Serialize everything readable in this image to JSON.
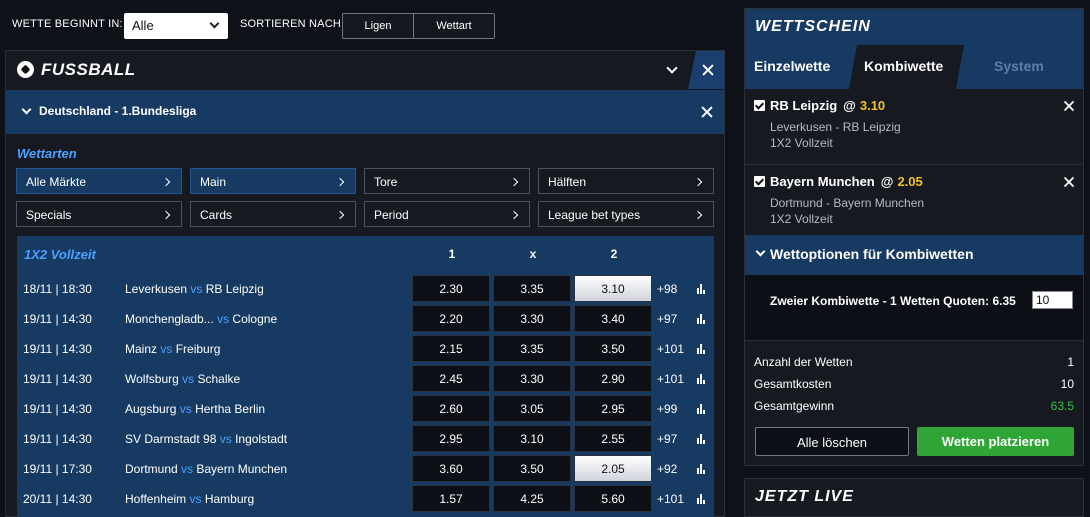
{
  "filter": {
    "start_label": "WETTE BEGINNT IN:",
    "start_value": "Alle",
    "sort_label": "SORTIEREN NACH:",
    "sort_options": [
      "Ligen",
      "Wettart"
    ]
  },
  "sport": {
    "title": "FUSSBALL",
    "icon": "soccer-ball-icon"
  },
  "league": {
    "title": "Deutschland - 1.Bundesliga"
  },
  "wettarten": {
    "title": "Wettarten",
    "markets": [
      {
        "label": "Alle Märkte",
        "active": true
      },
      {
        "label": "Main",
        "active": true
      },
      {
        "label": "Tore",
        "active": false
      },
      {
        "label": "Hälften",
        "active": false
      },
      {
        "label": "Specials",
        "active": false
      },
      {
        "label": "Cards",
        "active": false
      },
      {
        "label": "Period",
        "active": false
      },
      {
        "label": "League bet types",
        "active": false
      }
    ]
  },
  "table": {
    "title": "1X2 Vollzeit",
    "columns": [
      "1",
      "x",
      "2"
    ],
    "vs": "vs",
    "rows": [
      {
        "datetime": "18/11 | 18:30",
        "home": "Leverkusen",
        "away": "RB Leipzig",
        "odds": [
          "2.30",
          "3.35",
          "3.10"
        ],
        "selected": 2,
        "more": "+98"
      },
      {
        "datetime": "19/11 | 14:30",
        "home": "Monchengladb...",
        "away": "Cologne",
        "odds": [
          "2.20",
          "3.30",
          "3.40"
        ],
        "selected": -1,
        "more": "+97"
      },
      {
        "datetime": "19/11 | 14:30",
        "home": "Mainz",
        "away": "Freiburg",
        "odds": [
          "2.15",
          "3.35",
          "3.50"
        ],
        "selected": -1,
        "more": "+101"
      },
      {
        "datetime": "19/11 | 14:30",
        "home": "Wolfsburg",
        "away": "Schalke",
        "odds": [
          "2.45",
          "3.30",
          "2.90"
        ],
        "selected": -1,
        "more": "+101"
      },
      {
        "datetime": "19/11 | 14:30",
        "home": "Augsburg",
        "away": "Hertha Berlin",
        "odds": [
          "2.60",
          "3.05",
          "2.95"
        ],
        "selected": -1,
        "more": "+99"
      },
      {
        "datetime": "19/11 | 14:30",
        "home": "SV Darmstadt 98",
        "away": "Ingolstadt",
        "odds": [
          "2.95",
          "3.10",
          "2.55"
        ],
        "selected": -1,
        "more": "+97"
      },
      {
        "datetime": "19/11 | 17:30",
        "home": "Dortmund",
        "away": "Bayern Munchen",
        "odds": [
          "3.60",
          "3.50",
          "2.05"
        ],
        "selected": 2,
        "more": "+92"
      },
      {
        "datetime": "20/11 | 14:30",
        "home": "Hoffenheim",
        "away": "Hamburg",
        "odds": [
          "1.57",
          "4.25",
          "5.60"
        ],
        "selected": -1,
        "more": "+101"
      }
    ]
  },
  "slip": {
    "title": "WETTSCHEIN",
    "tabs": [
      "Einzelwette",
      "Kombiwette",
      "System"
    ],
    "active_tab": "Kombiwette",
    "at": "@",
    "bets": [
      {
        "team": "RB Leipzig",
        "odds": "3.10",
        "fixture": "Leverkusen - RB Leipzig",
        "type": "1X2 Vollzeit"
      },
      {
        "team": "Bayern Munchen",
        "odds": "2.05",
        "fixture": "Dortmund - Bayern Munchen",
        "type": "1X2 Vollzeit"
      }
    ],
    "options_title": "Wettoptionen für Kombiwetten",
    "combo_text": "Zweier Kombiwette - 1 Wetten Quoten: 6.35",
    "stake": "10",
    "summary": [
      {
        "label": "Anzahl der Wetten",
        "value": "1"
      },
      {
        "label": "Gesamtkosten",
        "value": "10"
      },
      {
        "label": "Gesamtgewinn",
        "value": "63.5"
      }
    ],
    "clear_label": "Alle löschen",
    "place_label": "Wetten platzieren"
  },
  "live": {
    "title": "JETZT LIVE"
  },
  "colors": {
    "accent_blue": "#4aa0ff",
    "panel_blue": "#173a63",
    "odds_yellow": "#f3c123",
    "win_green": "#38c03f",
    "place_green": "#2ea534"
  }
}
